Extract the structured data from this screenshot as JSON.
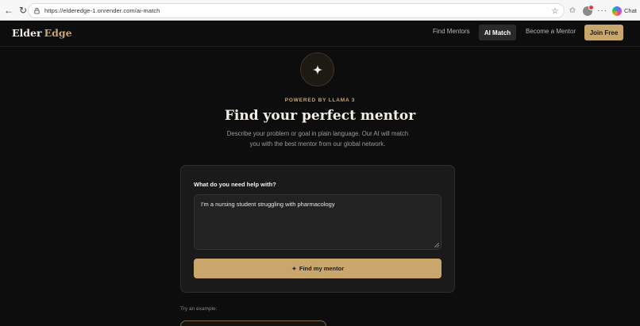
{
  "browser": {
    "url": "https://elderedge-1.onrender.com/ai-match",
    "chat_label": "Chat"
  },
  "site": {
    "logo_part1": "Elder",
    "logo_part2": "Edge",
    "nav": {
      "find_mentors": "Find Mentors",
      "ai_match": "AI Match",
      "become_mentor": "Become a Mentor",
      "join_free": "Join Free"
    }
  },
  "hero": {
    "icon": "sparkle-icon",
    "powered_by": "POWERED BY LLAMA 3",
    "title": "Find your perfect mentor",
    "description": "Describe your problem or goal in plain language. Our AI will match you with the best mentor from our global network."
  },
  "form": {
    "label": "What do you need help with?",
    "value": "I'm a nursing student struggling with pharmacology",
    "submit_label": "Find my mentor",
    "submit_icon": "sparkle-icon"
  },
  "examples": {
    "label": "Try an example:"
  },
  "colors": {
    "accent": "#c9a66b",
    "background": "#0d0d0d",
    "card": "#1a1a1a"
  }
}
